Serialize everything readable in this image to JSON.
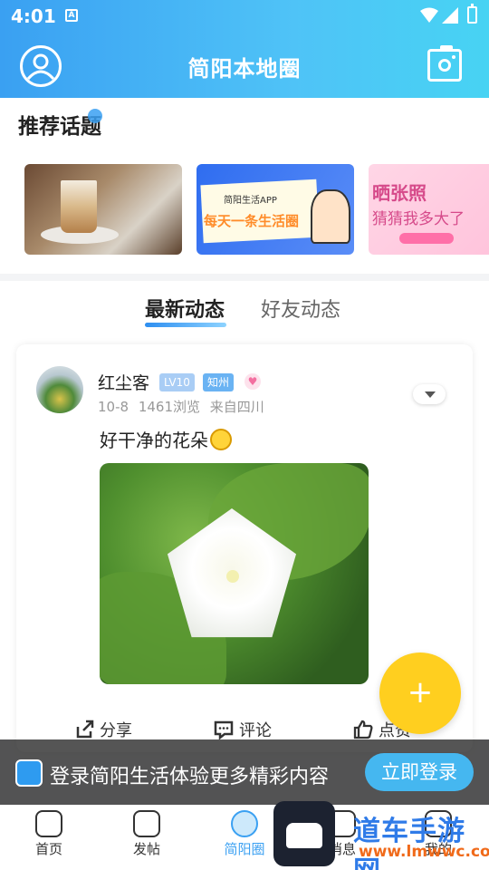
{
  "status_bar": {
    "time": "4:01"
  },
  "header": {
    "title": "简阳本地圈"
  },
  "topics": {
    "title": "推荐话题",
    "cards": [
      {
        "name": "coffee-photo"
      },
      {
        "caption_small": "简阳生活APP",
        "caption_big": "每天一条生活圈"
      },
      {
        "caption_line1": "晒张照",
        "caption_line2": "猜猜我多大了"
      }
    ]
  },
  "tabs": [
    {
      "label": "最新动态"
    },
    {
      "label": "好友动态"
    }
  ],
  "post": {
    "user": "红尘客",
    "level": "LV10",
    "badge": "知州",
    "date": "10-8",
    "views": "1461浏览",
    "location": "来自四川",
    "text": "好干净的花朵",
    "actions": {
      "share": "分享",
      "comment": "评论",
      "like": "点赞"
    }
  },
  "fab": {
    "symbol": "+"
  },
  "login_bar": {
    "text": "登录简阳生活体验更多精彩内容",
    "button": "立即登录"
  },
  "bottom_nav": [
    {
      "label": "首页"
    },
    {
      "label": "发帖"
    },
    {
      "label": "简阳圈"
    },
    {
      "label": "消息"
    },
    {
      "label": "我的"
    }
  ],
  "watermark": {
    "line1": "道车手游网",
    "line2": "www.lmwwc.com"
  },
  "colors": {
    "accent": "#3aa0f2",
    "fab": "#ffcf1f",
    "login_button": "#45b7f0"
  }
}
